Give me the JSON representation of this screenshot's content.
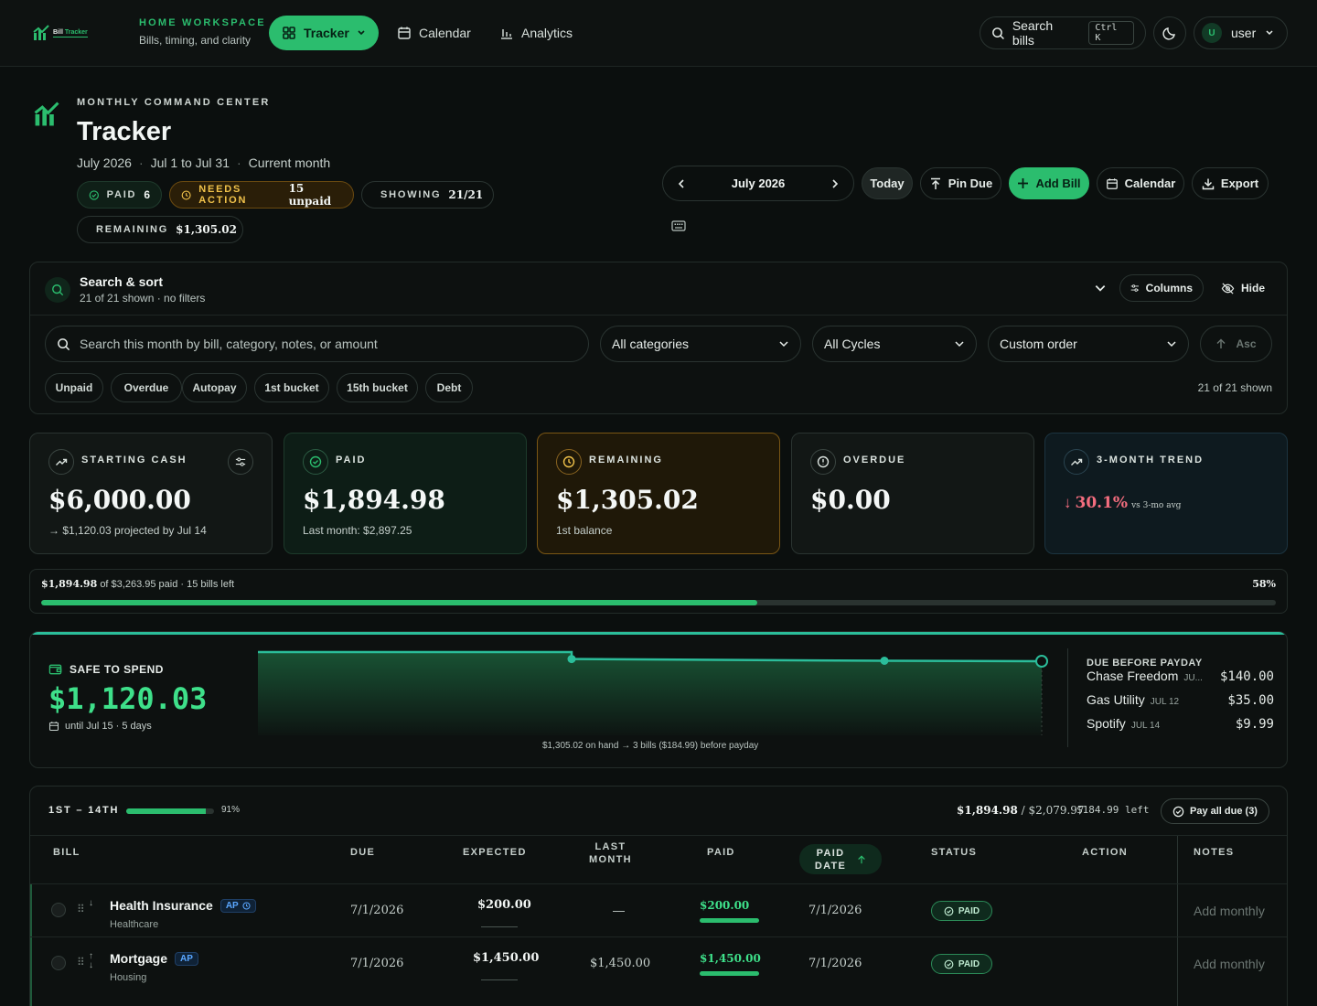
{
  "brand": {
    "logo_text_a": "Bill",
    "logo_text_b": "Tracker"
  },
  "workspace": {
    "title": "HOME WORKSPACE",
    "subtitle": "Bills, timing, and clarity"
  },
  "nav": {
    "tracker": "Tracker",
    "calendar": "Calendar",
    "analytics": "Analytics"
  },
  "topbar": {
    "search_label": "Search bills",
    "search_shortcut": "Ctrl K",
    "user_initial": "U",
    "user_name": "user"
  },
  "header": {
    "kicker": "MONTHLY COMMAND CENTER",
    "title": "Tracker",
    "month": "July 2026",
    "range": "Jul 1 to Jul 31",
    "scope": "Current month",
    "chips": {
      "paid_label": "PAID",
      "paid_value": "6",
      "needs_label": "NEEDS ACTION",
      "needs_value": "15 unpaid",
      "showing_label": "SHOWING",
      "showing_value": "21/21",
      "remaining_label": "REMAINING",
      "remaining_value": "$1,305.02"
    }
  },
  "toolbar": {
    "month_label": "July 2026",
    "today": "Today",
    "pin_due": "Pin Due",
    "add_bill": "Add Bill",
    "calendar": "Calendar",
    "export": "Export"
  },
  "search_panel": {
    "title": "Search & sort",
    "subtitle": "21 of 21 shown · no filters",
    "columns_btn": "Columns",
    "hide_btn": "Hide",
    "search_placeholder": "Search this month by bill, category, notes, or amount",
    "category_select": "All categories",
    "cycle_select": "All Cycles",
    "order_select": "Custom order",
    "asc_btn": "Asc",
    "filters": [
      "Unpaid",
      "Overdue",
      "Autopay",
      "1st bucket",
      "15th bucket",
      "Debt"
    ],
    "shown_count": "21 of 21 shown"
  },
  "cards": {
    "starting": {
      "label": "STARTING CASH",
      "value": "$6,000.00",
      "sub": "→ $1,120.03 projected by Jul 14"
    },
    "paid": {
      "label": "PAID",
      "value": "$1,894.98",
      "sub": "Last month: $2,897.25"
    },
    "remaining": {
      "label": "REMAINING",
      "value": "$1,305.02",
      "sub": "1st balance"
    },
    "overdue": {
      "label": "OVERDUE",
      "value": "$0.00"
    },
    "trend": {
      "label": "3-MONTH TREND",
      "arrow": "↓",
      "value": "30.1%",
      "note": "vs 3-mo avg"
    }
  },
  "progress": {
    "paid": "$1,894.98",
    "of_text": "of $3,263.95 paid · 15 bills left",
    "percent_label": "58%",
    "fraction": 0.58
  },
  "safe_to_spend": {
    "label": "SAFE TO SPEND",
    "value": "$1,120.03",
    "until": "until Jul 15 · 5 days",
    "caption": "$1,305.02 on hand → 3 bills ($184.99) before payday",
    "sparkline": [
      1305.02,
      1305.02,
      1165.02,
      1130.02,
      1120.03
    ]
  },
  "due_before_payday": {
    "title": "DUE BEFORE PAYDAY",
    "items": [
      {
        "name": "Chase Freedom",
        "date": "JU...",
        "amount": "$140.00"
      },
      {
        "name": "Gas Utility",
        "date": "JUL 12",
        "amount": "$35.00"
      },
      {
        "name": "Spotify",
        "date": "JUL 14",
        "amount": "$9.99"
      }
    ]
  },
  "bucket": {
    "title": "1ST – 14TH",
    "percent_label": "91%",
    "fraction": 0.91,
    "paid_total": "$1,894.98",
    "expected_total": "/ $2,079.97",
    "left": "$184.99 left",
    "pay_all": "Pay all due (3)"
  },
  "table": {
    "headers": {
      "bill": "BILL",
      "due": "DUE",
      "expected": "EXPECTED",
      "last_month_1": "LAST",
      "last_month_2": "MONTH",
      "paid": "PAID",
      "paid_date_1": "PAID",
      "paid_date_2": "DATE",
      "status": "STATUS",
      "action": "ACTION",
      "notes": "NOTES"
    },
    "rows": [
      {
        "name": "Health Insurance",
        "badge": "AP",
        "category": "Healthcare",
        "due": "7/1/2026",
        "expected": "$200.00",
        "last_month": "—",
        "paid": "$200.00",
        "paid_date": "7/1/2026",
        "status": "PAID",
        "notes": "Add monthly"
      },
      {
        "name": "Mortgage",
        "badge": "AP",
        "category": "Housing",
        "due": "7/1/2026",
        "expected": "$1,450.00",
        "last_month": "$1,450.00",
        "paid": "$1,450.00",
        "paid_date": "7/1/2026",
        "status": "PAID",
        "notes": "Add monthly"
      }
    ]
  },
  "colors": {
    "accent": "#2bbd6e",
    "warning": "#f0c24a",
    "danger": "#f36d7e",
    "background": "#0b0f0e"
  }
}
